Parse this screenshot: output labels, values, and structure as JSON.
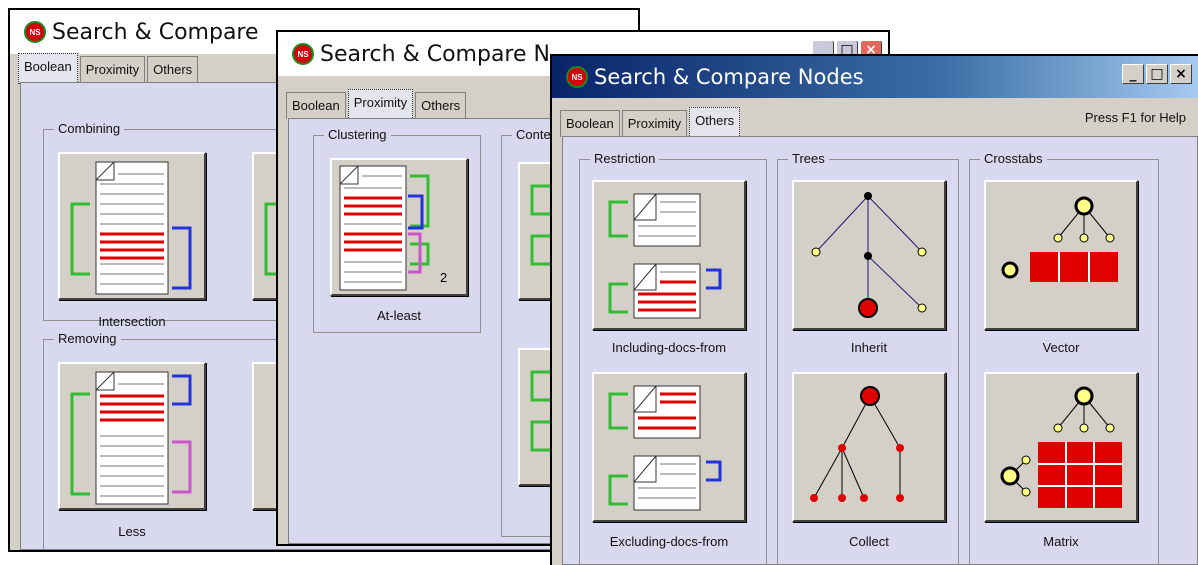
{
  "windows": [
    {
      "title": "Search & Compare",
      "tabs": [
        "Boolean",
        "Proximity",
        "Others"
      ],
      "active_tab": "Boolean",
      "groups": [
        {
          "label": "Combining",
          "tools": [
            "Intersection"
          ]
        },
        {
          "label": "Removing",
          "tools": [
            "Less"
          ]
        }
      ]
    },
    {
      "title": "Search & Compare N",
      "tabs": [
        "Boolean",
        "Proximity",
        "Others"
      ],
      "active_tab": "Proximity",
      "groups": [
        {
          "label": "Clustering",
          "tools": [
            {
              "label": "At-least",
              "badge": "2"
            }
          ]
        },
        {
          "label": "Conte",
          "tools": []
        }
      ]
    },
    {
      "title": "Search & Compare Nodes",
      "tabs": [
        "Boolean",
        "Proximity",
        "Others"
      ],
      "active_tab": "Others",
      "help": "Press F1 for Help",
      "groups": [
        {
          "label": "Restriction",
          "tools": [
            "Including-docs-from",
            "Excluding-docs-from"
          ]
        },
        {
          "label": "Trees",
          "tools": [
            "Inherit",
            "Collect"
          ]
        },
        {
          "label": "Crosstabs",
          "tools": [
            "Vector",
            "Matrix"
          ]
        }
      ]
    }
  ],
  "app_icon": "ns-logo-icon",
  "window_buttons": {
    "minimize": "_",
    "maximize": "□",
    "close": "×"
  }
}
